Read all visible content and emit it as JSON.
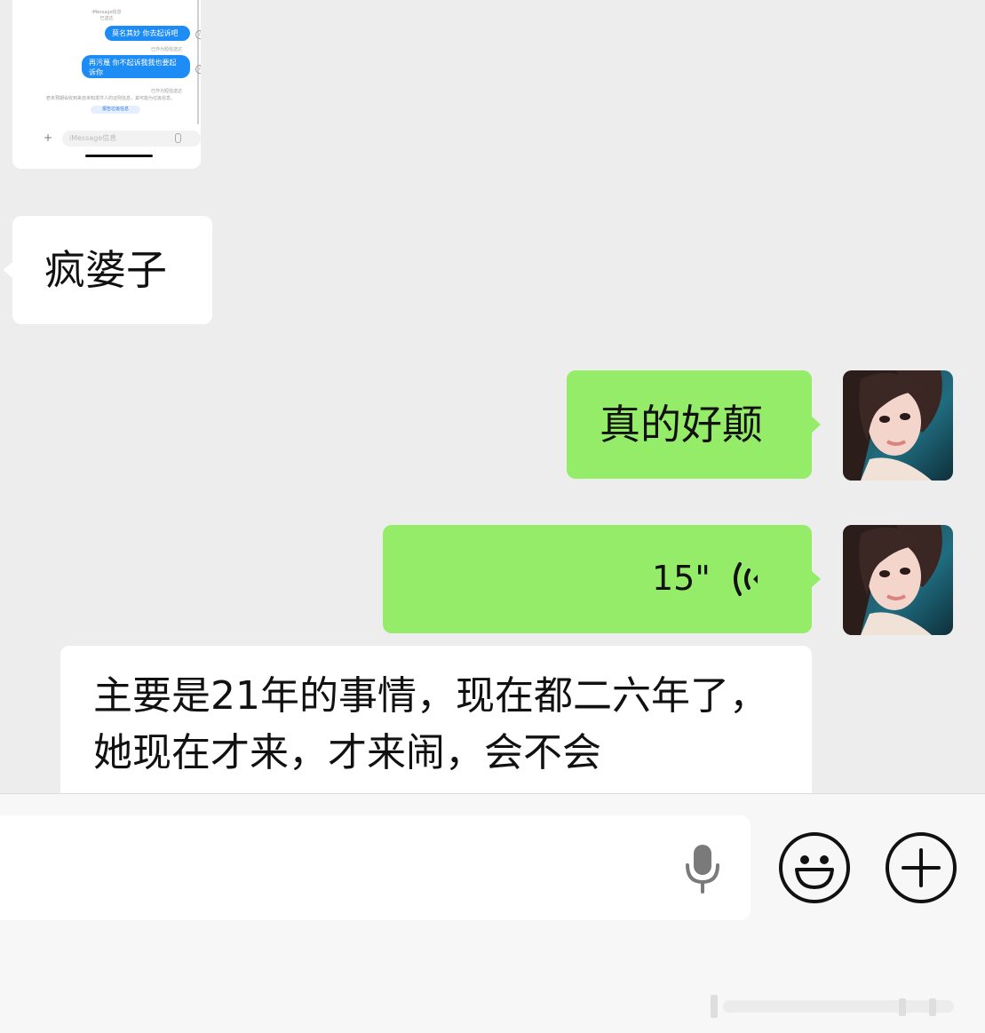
{
  "embedded_screenshot": {
    "header": "iMessage信息",
    "delivered": "已送达",
    "bubble_1": "莫名其妙 你去起诉吧",
    "bubble_1_status": "已作为短信送达",
    "bubble_2": "再污蔑 你不起诉我我也要起诉你",
    "bubble_2_status": "已作为短信送达",
    "notice": "若未预期会收到来自未知发件人的这则信息，其可能为垃圾信息。",
    "report_link": "报告垃圾信息",
    "input_placeholder": "iMessage信息"
  },
  "messages": [
    {
      "side": "left",
      "type": "text",
      "text": "疯婆子"
    },
    {
      "side": "right",
      "type": "text",
      "text": "真的好颠"
    },
    {
      "side": "right",
      "type": "voice",
      "duration": "15\""
    },
    {
      "side": "left",
      "type": "text",
      "text": "主要是21年的事情，现在都二六年了，她现在才来，才来闹，会不会"
    }
  ],
  "colors": {
    "background": "#ededed",
    "sent_bubble": "#95ec69",
    "received_bubble": "#ffffff",
    "imessage_blue": "#1e8cf5"
  },
  "icons": [
    "microphone-icon",
    "emoji-icon",
    "plus-icon",
    "voice-wave-icon",
    "info-icon"
  ]
}
